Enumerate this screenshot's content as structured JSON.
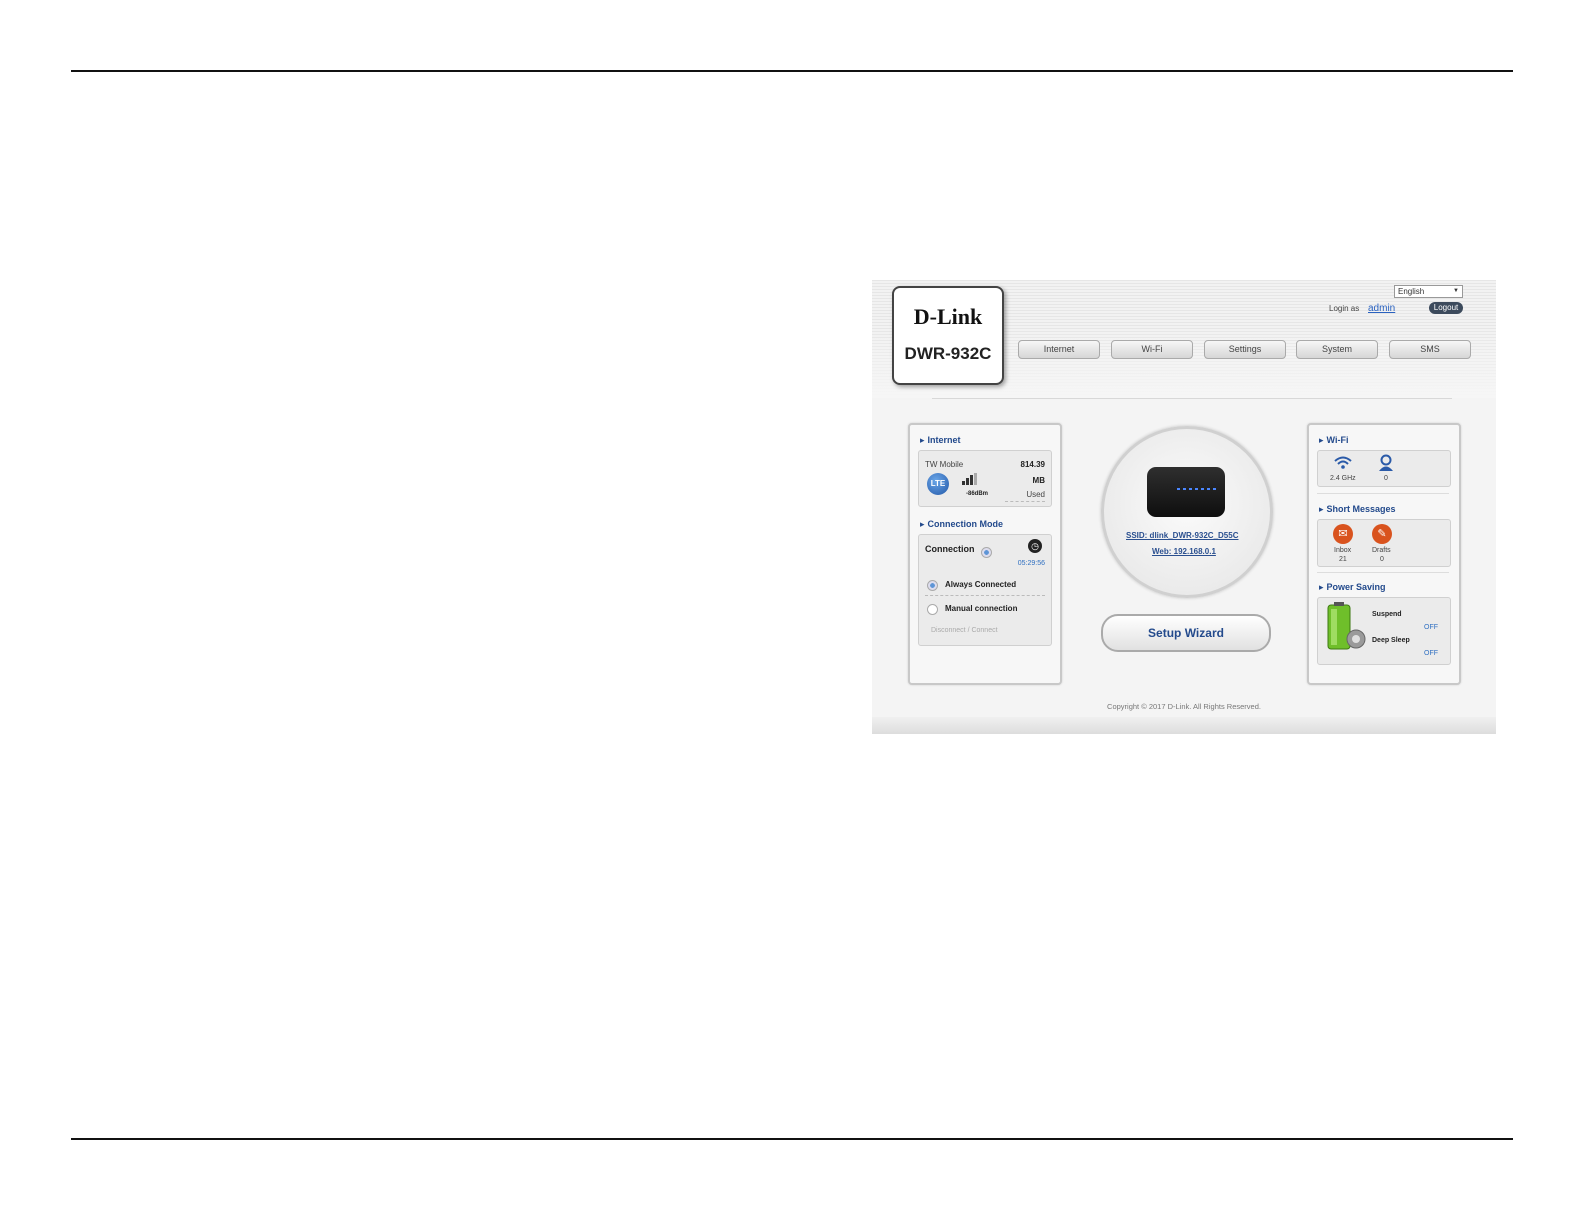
{
  "header": {
    "brand": "D-Link",
    "model": "DWR-932C"
  },
  "top_bar": {
    "language": "English",
    "login_as_label": "Login as",
    "login_user": "admin",
    "logout_label": "Logout"
  },
  "nav": [
    "Internet",
    "Wi-Fi",
    "Settings",
    "System",
    "SMS"
  ],
  "internet_panel": {
    "title": "Internet",
    "provider": "TW Mobile",
    "network_type": "LTE",
    "signal": "-86dBm",
    "usage_value": "814.39",
    "usage_unit": "MB",
    "usage_label": "Used"
  },
  "connection_mode": {
    "title": "Connection Mode",
    "connection_label": "Connection",
    "timer": "05:29:56",
    "option_always": "Always Connected",
    "option_manual": "Manual connection",
    "disconnect_connect": "Disconnect / Connect"
  },
  "center": {
    "ssid": "SSID: dlink_DWR-932C_D55C",
    "web": "Web: 192.168.0.1",
    "setup_wizard": "Setup Wizard"
  },
  "wifi_panel": {
    "title": "Wi-Fi",
    "band": "2.4 GHz",
    "clients": "0"
  },
  "sms_panel": {
    "title": "Short Messages",
    "inbox_label": "Inbox",
    "inbox_count": "21",
    "drafts_label": "Drafts",
    "drafts_count": "0"
  },
  "power_panel": {
    "title": "Power Saving",
    "suspend_label": "Suspend",
    "suspend_value": "OFF",
    "deep_sleep_label": "Deep Sleep",
    "deep_sleep_value": "OFF"
  },
  "copyright": "Copyright © 2017 D-Link. All Rights Reserved.",
  "colors": {
    "accent": "#234a8c",
    "link": "#2f6fc1",
    "logout_bg": "#3c4a5c"
  }
}
